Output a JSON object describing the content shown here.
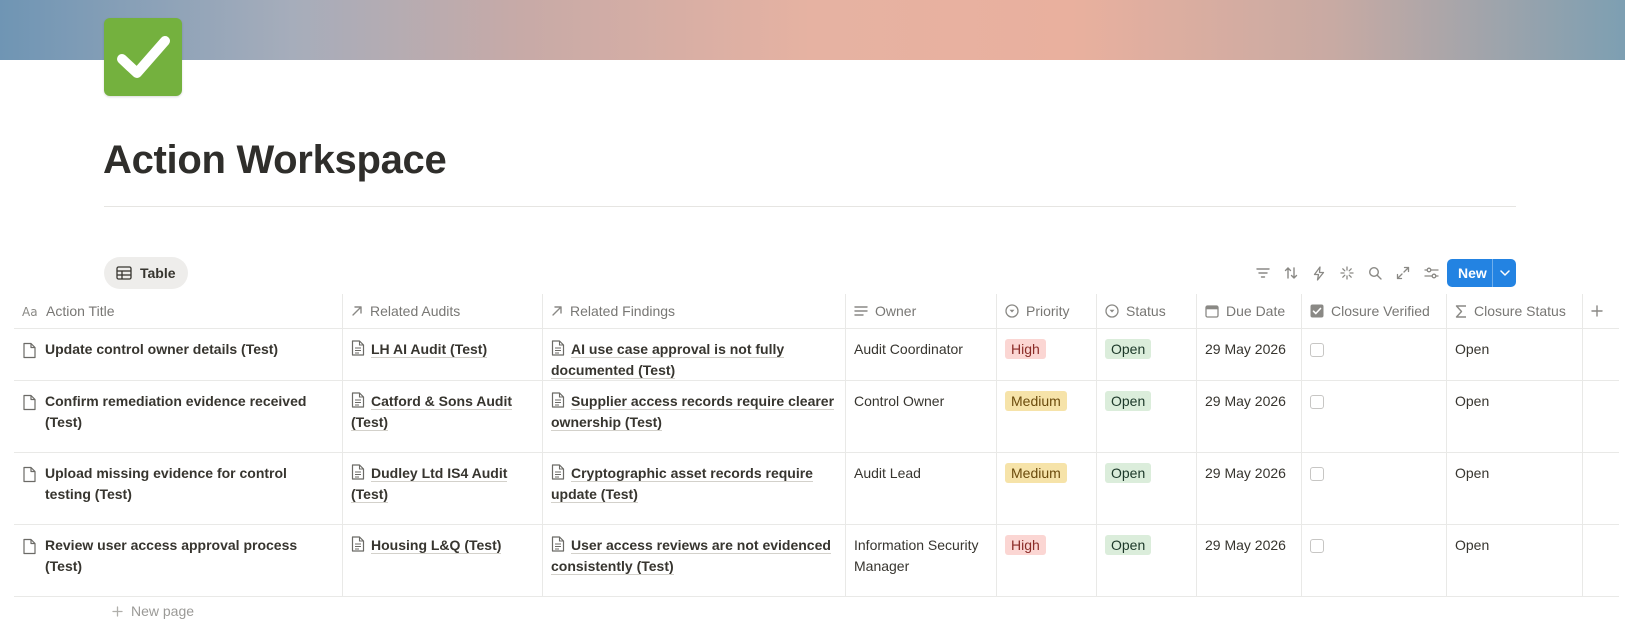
{
  "page": {
    "title": "Action Workspace",
    "icon": "check-mark-icon"
  },
  "view": {
    "tab_label": "Table",
    "new_button_label": "New",
    "toolbar_icons": [
      "filter-icon",
      "sort-icon",
      "automation-icon",
      "ai-icon",
      "search-icon",
      "expand-icon",
      "settings-icon"
    ]
  },
  "table": {
    "columns": [
      {
        "label": "Action Title",
        "icon": "title-type-icon"
      },
      {
        "label": "Related Audits",
        "icon": "relation-arrow-icon"
      },
      {
        "label": "Related Findings",
        "icon": "relation-arrow-icon"
      },
      {
        "label": "Owner",
        "icon": "text-type-icon"
      },
      {
        "label": "Priority",
        "icon": "select-type-icon"
      },
      {
        "label": "Status",
        "icon": "status-type-icon"
      },
      {
        "label": "Due Date",
        "icon": "calendar-icon"
      },
      {
        "label": "Closure Verified",
        "icon": "checkbox-type-icon"
      },
      {
        "label": "Closure Status",
        "icon": "formula-icon"
      }
    ],
    "rows": [
      {
        "title": "Update control owner details (Test)",
        "audit": "LH AI Audit (Test)",
        "finding": "AI use case approval is not fully documented (Test)",
        "owner": "Audit Coordinator",
        "priority": "High",
        "status": "Open",
        "due": "29 May 2026",
        "verified": false,
        "closure": "Open"
      },
      {
        "title": "Confirm remediation evidence received (Test)",
        "audit": "Catford & Sons Audit (Test)",
        "finding": "Supplier access records require clearer ownership (Test)",
        "owner": "Control Owner",
        "priority": "Medium",
        "status": "Open",
        "due": "29 May 2026",
        "verified": false,
        "closure": "Open"
      },
      {
        "title": "Upload missing evidence for control testing (Test)",
        "audit": "Dudley Ltd IS4 Audit (Test)",
        "finding": "Cryptographic asset records require update (Test)",
        "owner": "Audit Lead",
        "priority": "Medium",
        "status": "Open",
        "due": "29 May 2026",
        "verified": false,
        "closure": "Open"
      },
      {
        "title": "Review user access approval process (Test)",
        "audit": "Housing L&Q (Test)",
        "finding": "User access reviews are not evidenced consistently (Test)",
        "owner": "Information Security Manager",
        "priority": "High",
        "status": "Open",
        "due": "29 May 2026",
        "verified": false,
        "closure": "Open"
      }
    ],
    "new_page_label": "New page"
  },
  "colors": {
    "accent": "#2383e2",
    "high_bg": "#fbd6d3",
    "high_fg": "#8a2b27",
    "medium_bg": "#f6e3a9",
    "medium_fg": "#6b4b0c",
    "open_bg": "#dbeddb",
    "open_fg": "#1c3829"
  }
}
